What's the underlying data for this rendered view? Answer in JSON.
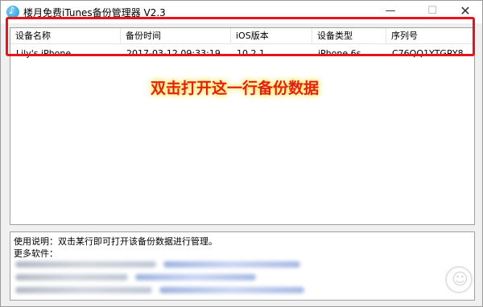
{
  "window": {
    "title": "楼月免费iTunes备份管理器 V2.3",
    "controls": {
      "minimize": "—",
      "maximize": "☐",
      "close": "✕"
    }
  },
  "list": {
    "columns": [
      "设备名称",
      "备份时间",
      "iOS版本",
      "设备类型",
      "序列号"
    ],
    "rows": [
      {
        "device_name": "Lily's iPhone",
        "backup_time": "2017-03-12 09:33:19",
        "ios_version": "10.2.1",
        "device_type": "iPhone 6s",
        "serial": "C76QQ1YTGRY8"
      }
    ]
  },
  "annotation": "双击打开这一行备份数据",
  "info": {
    "usage": "使用说明：双击某行即可打开该备份数据进行管理。",
    "more_software": "更多软件："
  },
  "colors": {
    "highlight": "#e8141b",
    "annotation_text": "#e02020",
    "annotation_glow": "#ffd800"
  }
}
